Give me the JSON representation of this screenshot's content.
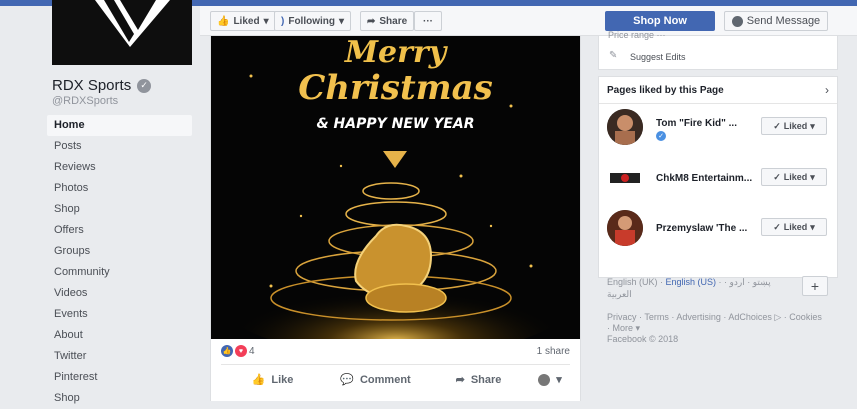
{
  "page": {
    "name": "RDX Sports",
    "handle": "@RDXSports",
    "verified_mark": "✓"
  },
  "nav": {
    "items": [
      "Home",
      "Posts",
      "Reviews",
      "Photos",
      "Shop",
      "Offers",
      "Groups",
      "Community",
      "Videos",
      "Events",
      "About",
      "Twitter",
      "Pinterest",
      "Shop"
    ]
  },
  "actionbar": {
    "liked": "Liked",
    "following": "Following",
    "share": "Share",
    "more": "···",
    "shop_now": "Shop Now",
    "send_message": "Send Message"
  },
  "post": {
    "image_text": {
      "line1": "Merry",
      "line2": "Christmas",
      "line3": "& HAPPY NEW YEAR"
    },
    "reaction_count": "4",
    "shares": "1 share",
    "actions": {
      "like": "Like",
      "comment": "Comment",
      "share": "Share"
    }
  },
  "sidebar_top": {
    "partial": "Price range ···",
    "suggest_edits": "Suggest Edits"
  },
  "pages_liked": {
    "title": "Pages liked by this Page",
    "items": [
      {
        "name": "Tom \"Fire Kid\" ...",
        "button": "Liked"
      },
      {
        "name": "ChkM8 Entertainm...",
        "button": "Liked"
      },
      {
        "name": "Przemyslaw 'The ...",
        "button": "Liked"
      }
    ]
  },
  "languages": {
    "current": "English (UK)",
    "alt": "English (US)",
    "others": "· پښتو · اردو · العربية",
    "plus": "+"
  },
  "footer": {
    "links": "Privacy · Terms · Advertising · AdChoices ▷ · Cookies · More ▾",
    "copyright": "Facebook © 2018"
  },
  "colors": {
    "brand": "#4267b2",
    "gold": "#f2c14e",
    "background": "#e9ebee"
  }
}
